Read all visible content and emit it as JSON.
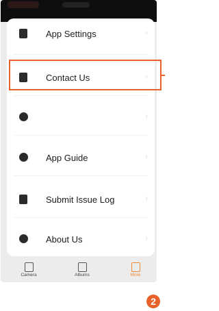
{
  "menu": {
    "items": [
      {
        "label": "App Settings",
        "icon": "settings-icon"
      },
      {
        "label": "Contact Us",
        "icon": "contact-icon"
      },
      {
        "label": "",
        "icon": "globe-icon"
      },
      {
        "label": "App Guide",
        "icon": "guide-icon"
      },
      {
        "label": "Submit Issue Log",
        "icon": "log-icon"
      },
      {
        "label": "About Us",
        "icon": "info-icon"
      }
    ],
    "chevron": "›"
  },
  "tabbar": {
    "tabs": [
      {
        "label": "Camera",
        "icon": "camera-icon"
      },
      {
        "label": "Albums",
        "icon": "albums-icon"
      },
      {
        "label": "More",
        "icon": "more-icon",
        "active": true
      }
    ]
  },
  "annotation": {
    "step_number": "2",
    "accent_color": "#e8602a"
  }
}
